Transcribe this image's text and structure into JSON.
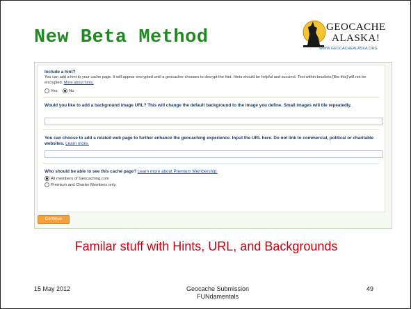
{
  "slide": {
    "title": "New Beta Method",
    "caption": "Familar stuff with Hints, URL, and Backgrounds",
    "footer_date": "15 May 2012",
    "footer_line1": "Geocache Submission",
    "footer_line2": "FUNdamentals",
    "page_number": "49"
  },
  "logo": {
    "line1": "GEOCACHE",
    "line2": "ALASKA!",
    "url": "WWW.GEOCACHEALASKA.ORG",
    "icon": "howling-wolf-icon"
  },
  "form": {
    "hint_label": "Include a hint?",
    "hint_desc": "You can add a hint to your cache page. It will appear encrypted until a geocacher chooses to decrypt the hint. Hints should be helpful and succinct. Text within brackets [like this] will not be encrypted.",
    "hint_link": "More about hints.",
    "hint_yes": "Yes",
    "hint_no": "No",
    "bg_label": "Would you like to add a background image URL? This will change the default background to the image you define. Small images will tile repeatedly.",
    "related_label": "You can choose to add a related web page to further enhance the geocaching experience. Input the URL here. Do not link to commercial, political or charitable websites.",
    "related_link": "Learn more.",
    "visibility_label": "Who should be able to see this cache page?",
    "visibility_link": "Learn more about Premium Membership.",
    "visibility_all": "All members of Geocaching.com",
    "visibility_premium": "Premium and Charter Members only.",
    "continue_label": "Continue"
  },
  "colors": {
    "title": "#1f8a1f",
    "caption": "#c4000e",
    "button": "#f4a13c",
    "link": "#1a4db0"
  }
}
